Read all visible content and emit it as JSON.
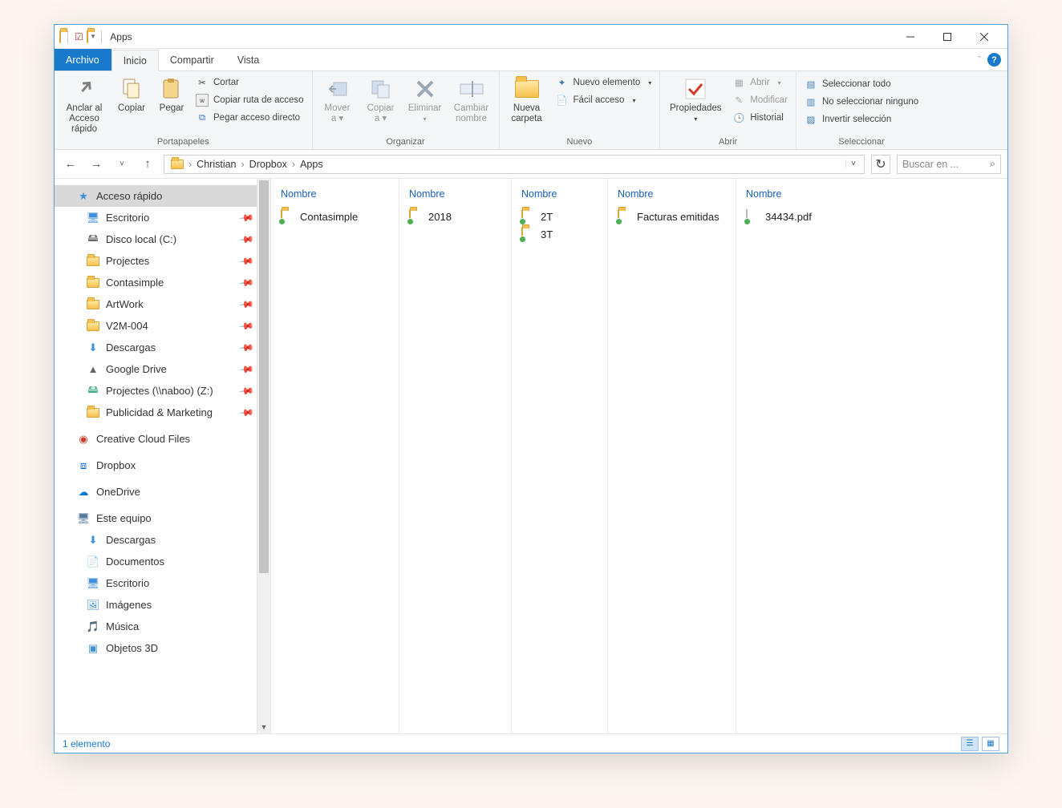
{
  "window": {
    "title": "Apps"
  },
  "tabs": {
    "archivo": "Archivo",
    "inicio": "Inicio",
    "compartir": "Compartir",
    "vista": "Vista"
  },
  "ribbon": {
    "portapapeles": {
      "label": "Portapapeles",
      "anclar": "Anclar al\nAcceso rápido",
      "copiar": "Copiar",
      "pegar": "Pegar",
      "cortar": "Cortar",
      "copiar_ruta": "Copiar ruta de acceso",
      "pegar_acceso": "Pegar acceso directo"
    },
    "organizar": {
      "label": "Organizar",
      "mover": "Mover a",
      "copiar_a": "Copiar a",
      "eliminar": "Eliminar",
      "cambiar": "Cambiar nombre"
    },
    "nuevo": {
      "label": "Nuevo",
      "carpeta": "Nueva carpeta",
      "nuevo_elem": "Nuevo elemento",
      "facil": "Fácil acceso"
    },
    "abrir": {
      "label": "Abrir",
      "propiedades": "Propiedades",
      "abrir": "Abrir",
      "modificar": "Modificar",
      "historial": "Historial"
    },
    "seleccionar": {
      "label": "Seleccionar",
      "todo": "Seleccionar todo",
      "ninguno": "No seleccionar ninguno",
      "invertir": "Invertir selección"
    }
  },
  "breadcrumb": {
    "items": [
      "Christian",
      "Dropbox",
      "Apps"
    ]
  },
  "search": {
    "placeholder": "Buscar en ..."
  },
  "tree": {
    "quick": "Acceso rápido",
    "quick_items": [
      "Escritorio",
      "Disco local (C:)",
      "Projectes",
      "Contasimple",
      "ArtWork",
      "V2M-004",
      "Descargas",
      "Google Drive",
      "Projectes (\\\\naboo) (Z:)",
      "Publicidad & Marketing"
    ],
    "creative": "Creative Cloud Files",
    "dropbox": "Dropbox",
    "onedrive": "OneDrive",
    "equipo": "Este equipo",
    "equipo_items": [
      "Descargas",
      "Documentos",
      "Escritorio",
      "Imágenes",
      "Música",
      "Objetos 3D"
    ]
  },
  "columns": {
    "hdr": "Nombre",
    "c1": [
      "Contasimple"
    ],
    "c2": [
      "2018"
    ],
    "c3": [
      "2T",
      "3T"
    ],
    "c4": [
      "Facturas emitidas"
    ],
    "c5": [
      "34434.pdf"
    ]
  },
  "status": {
    "text": "1 elemento"
  }
}
